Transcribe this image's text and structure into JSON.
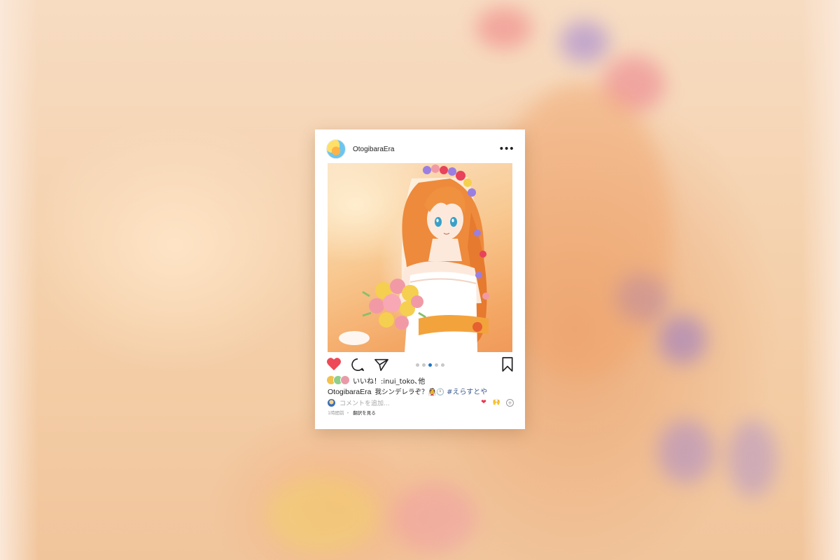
{
  "post": {
    "username": "OtogibaraEra",
    "more_icon": "more-horizontal-icon",
    "image_alt": "Anime illustration of an orange-haired girl in a white wedding dress with a flower crown and bouquet",
    "carousel": {
      "count": 5,
      "active_index": 2
    },
    "actions": {
      "like_icon": "heart-filled-icon",
      "comment_icon": "comment-icon",
      "share_icon": "send-icon",
      "save_icon": "bookmark-icon"
    },
    "likes_text": "いいね！:inui_toko､他",
    "caption": {
      "user": "OtogibaraEra",
      "text": "我シンデレラぞ？👰🕛",
      "hashtag": "#えらすとや"
    },
    "comment": {
      "placeholder": "コメントを追加...",
      "heart": "❤",
      "hands": "🙌",
      "plus": "+"
    },
    "meta": {
      "time": "1時間前 ・",
      "translate": "翻訳を見る"
    }
  },
  "colors": {
    "heart": "#ed4956",
    "active_dot": "#1e74c8",
    "hashtag": "#3a5a8f"
  }
}
